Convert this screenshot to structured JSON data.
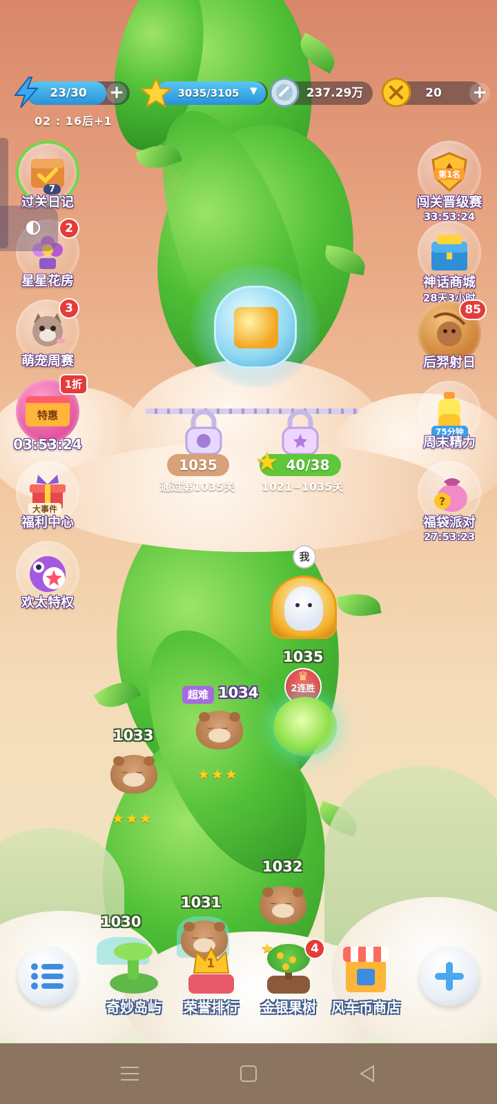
{
  "resources": {
    "energy": {
      "icon": "lightning-icon",
      "value": "23/30",
      "fill_fraction": 0.77
    },
    "stars": {
      "icon": "star-icon",
      "value": "3035/3105",
      "fill_fraction": 0.98
    },
    "coins": {
      "icon": "silver-coin-icon",
      "value": "237.29万"
    },
    "gold": {
      "icon": "gold-coin-icon",
      "value": "20"
    },
    "energy_timer": "02 : 16后+1",
    "plus": "+"
  },
  "left_sidebar": [
    {
      "label": "过关日记",
      "badge": "7",
      "icon": "diary-chest-icon"
    },
    {
      "label": "星星花房",
      "badge": "2",
      "icon": "flower-icon"
    },
    {
      "label": "萌宠周赛",
      "badge": "3",
      "icon": "cat-icon"
    },
    {
      "label": "特惠",
      "timer": "03:53:24",
      "badge": "1折",
      "icon": "shop-icon"
    },
    {
      "label": "福利中心",
      "tag": "大事件",
      "icon": "gift-icon"
    },
    {
      "label": "欢太特权",
      "icon": "privilege-icon"
    }
  ],
  "right_sidebar": [
    {
      "label": "闯关晋级赛",
      "sub": "33:53:24",
      "tag": "第1名",
      "icon": "trophy-shield-icon"
    },
    {
      "label": "神话商城",
      "sub": "28天3小时",
      "icon": "treasure-chest-icon"
    },
    {
      "label": "后羿射日",
      "badge": "85",
      "icon": "archer-icon"
    },
    {
      "label": "周末精力",
      "tag": "75分钟",
      "icon": "bottle-icon"
    },
    {
      "label": "福袋派对",
      "sub": "27:53:23",
      "icon": "lucky-bag-icon"
    }
  ],
  "locks": {
    "left": {
      "value": "1035",
      "desc": "通过第1035关"
    },
    "right": {
      "value": "40/38",
      "desc": "1021~1035关"
    }
  },
  "player": {
    "tag": "我",
    "level": "1035",
    "streak": "2连胜"
  },
  "levels": [
    {
      "num": "1034",
      "tag": "超难",
      "stars": "★★★"
    },
    {
      "num": "1033",
      "stars": "★★★"
    },
    {
      "num": "1032",
      "stars": "★★★"
    },
    {
      "num": "1031"
    },
    {
      "num": "1030"
    }
  ],
  "bottom_nav": [
    {
      "label": "奇妙岛屿",
      "icon": "island-icon"
    },
    {
      "label": "荣誉排行",
      "icon": "crown-icon",
      "rank": "1"
    },
    {
      "label": "金银果树",
      "icon": "fruit-tree-icon",
      "badge": "4"
    },
    {
      "label": "风车币商店",
      "icon": "store-icon"
    }
  ],
  "colors": {
    "accent": "#2a92d8",
    "badge": "#e53b3b",
    "stalk": "#4fbf36"
  }
}
